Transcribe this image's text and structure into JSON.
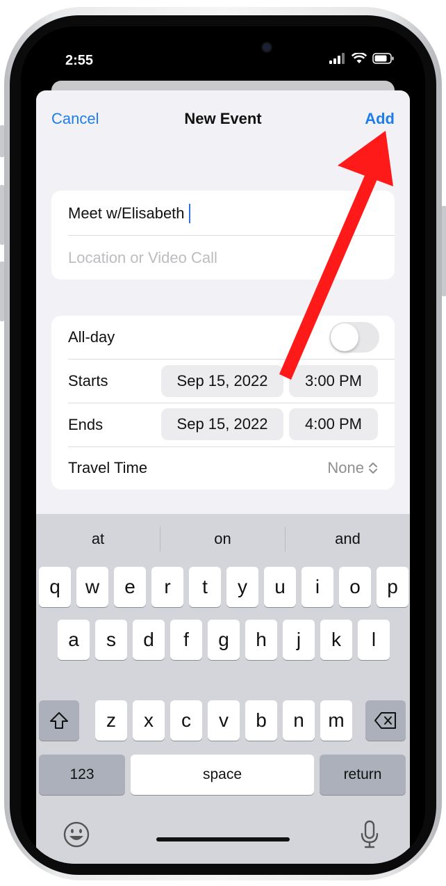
{
  "status": {
    "time": "2:55"
  },
  "nav": {
    "cancel": "Cancel",
    "title": "New Event",
    "add": "Add"
  },
  "event": {
    "title_value": "Meet w/Elisabeth",
    "location_placeholder": "Location or Video Call"
  },
  "schedule": {
    "allday_label": "All-day",
    "allday_on": false,
    "starts_label": "Starts",
    "starts_date": "Sep 15, 2022",
    "starts_time": "3:00 PM",
    "ends_label": "Ends",
    "ends_date": "Sep 15, 2022",
    "ends_time": "4:00 PM",
    "travel_label": "Travel Time",
    "travel_value": "None"
  },
  "keyboard": {
    "suggestions": [
      "at",
      "on",
      "and"
    ],
    "row1": [
      "q",
      "w",
      "e",
      "r",
      "t",
      "y",
      "u",
      "i",
      "o",
      "p"
    ],
    "row2": [
      "a",
      "s",
      "d",
      "f",
      "g",
      "h",
      "j",
      "k",
      "l"
    ],
    "row3": [
      "z",
      "x",
      "c",
      "v",
      "b",
      "n",
      "m"
    ],
    "numbers_key": "123",
    "space_key": "space",
    "return_key": "return"
  },
  "colors": {
    "accent": "#1e7de9",
    "annotation_arrow": "#ff1a1a"
  },
  "icons": [
    "signal-icon",
    "wifi-icon",
    "battery-icon",
    "chevron-updown-icon",
    "shift-icon",
    "delete-icon",
    "emoji-icon",
    "microphone-icon",
    "arrow-annotation"
  ]
}
